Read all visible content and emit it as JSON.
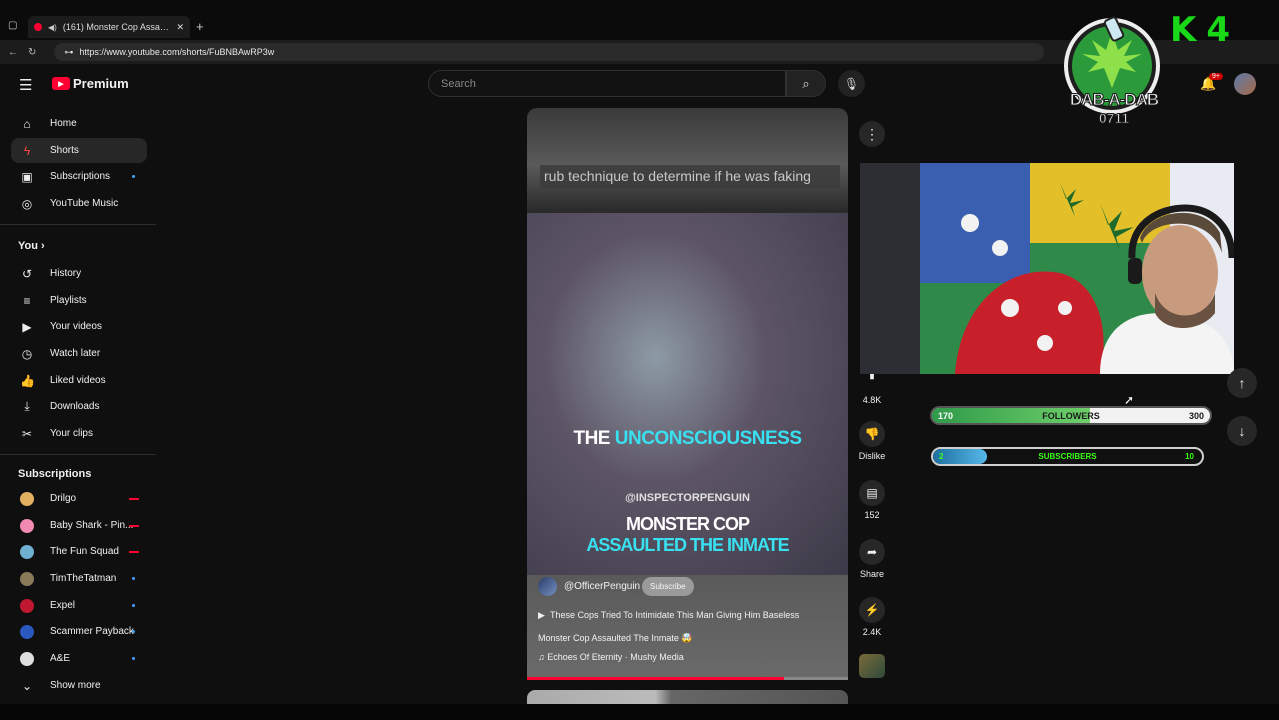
{
  "browser": {
    "tab_title": "(161) Monster Cop Assaulted...",
    "tab_close": "✕",
    "new_tab": "+",
    "url": "https://www.youtube.com/shorts/FuBNBAwRP3w"
  },
  "header": {
    "brand": "Premium",
    "search_placeholder": "Search",
    "notification_count": "9+"
  },
  "sidebar": {
    "main": [
      {
        "label": "Home",
        "icon": "home-icon"
      },
      {
        "label": "Shorts",
        "icon": "shorts-icon",
        "active": true
      },
      {
        "label": "Subscriptions",
        "icon": "subscriptions-icon"
      },
      {
        "label": "YouTube Music",
        "icon": "music-icon"
      }
    ],
    "you_title": "You",
    "you": [
      {
        "label": "History",
        "icon": "history-icon"
      },
      {
        "label": "Playlists",
        "icon": "playlists-icon"
      },
      {
        "label": "Your videos",
        "icon": "your-videos-icon"
      },
      {
        "label": "Watch later",
        "icon": "watch-later-icon"
      },
      {
        "label": "Liked videos",
        "icon": "like-icon"
      },
      {
        "label": "Downloads",
        "icon": "download-icon"
      },
      {
        "label": "Your clips",
        "icon": "clips-icon"
      }
    ],
    "subscriptions_title": "Subscriptions",
    "subscriptions": [
      {
        "label": "Drilgo",
        "color": "#e0b060",
        "status": "live"
      },
      {
        "label": "Baby Shark - Pin...",
        "color": "#f08ab0",
        "status": "live"
      },
      {
        "label": "The Fun Squad",
        "color": "#6fb0d0",
        "status": "live"
      },
      {
        "label": "TimTheTatman",
        "color": "#8a7a5a",
        "status": "new"
      },
      {
        "label": "Expel",
        "color": "#c01830",
        "status": "new"
      },
      {
        "label": "Scammer Payback",
        "color": "#2a5ac0",
        "status": "new"
      },
      {
        "label": "A&E",
        "color": "#dddddd",
        "status": "new"
      }
    ],
    "show_more": "Show more"
  },
  "video": {
    "top_text": "rub technique to determine if he was faking",
    "caption_word1": "THE",
    "caption_word2": "UNCONSCIOUSNESS",
    "watermark": "@INSPECTORPENGUIN",
    "caption_line2a": "MONSTER COP",
    "caption_line2b": "ASSAULTED THE INMATE",
    "channel": "@OfficerPenguin",
    "subscribe": "Subscribe",
    "playlist": "These Cops Tried To Intimidate This Man Giving Him Baseless",
    "title": "Monster Cop Assaulted The Inmate 🤯",
    "music": "Echoes Of Eternity · Mushy Media",
    "progress": 0.8
  },
  "actions": {
    "likes": "4.8K",
    "dislike": "Dislike",
    "comments": "152",
    "share": "Share",
    "remix": "2.4K"
  },
  "overlay": {
    "followers_current": "170",
    "followers_label": "FOLLOWERS",
    "followers_goal": "300",
    "followers_progress": 0.57,
    "subs_current": "2",
    "subs_label": "SUBSCRIBERS",
    "subs_goal": "10",
    "subs_progress": 0.2,
    "logo_text": "DAB-A-DAB",
    "logo_sub": "0711"
  }
}
